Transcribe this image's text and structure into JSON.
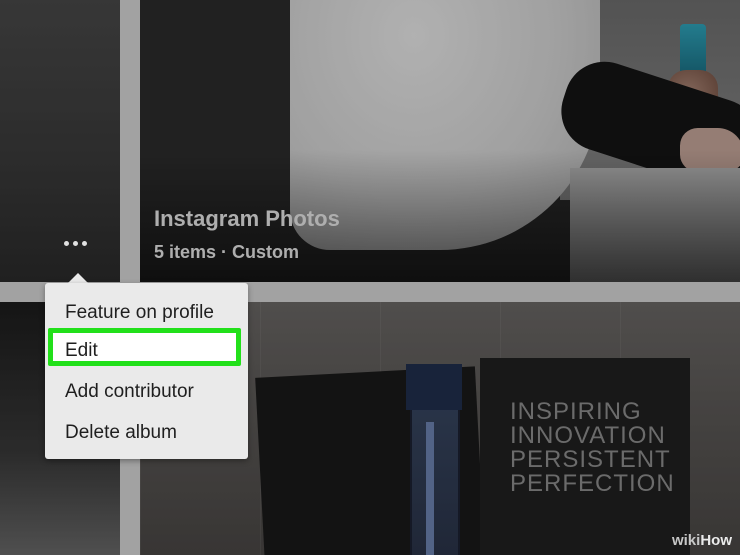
{
  "album": {
    "title": "Instagram Photos",
    "meta": "5 items · Custom"
  },
  "menu": {
    "items": [
      {
        "label": "Feature on profile"
      },
      {
        "label": "Edit"
      },
      {
        "label": "Add contributor"
      },
      {
        "label": "Delete album"
      }
    ],
    "highlight_color": "#22e01a"
  },
  "book": {
    "cover_text": "INSPIRING\nINNOVATION\nPERSISTENT\nPERFECTION"
  },
  "watermark": {
    "wiki": "wiki",
    "how": "How"
  },
  "icons": {
    "more": "more-options-icon"
  }
}
